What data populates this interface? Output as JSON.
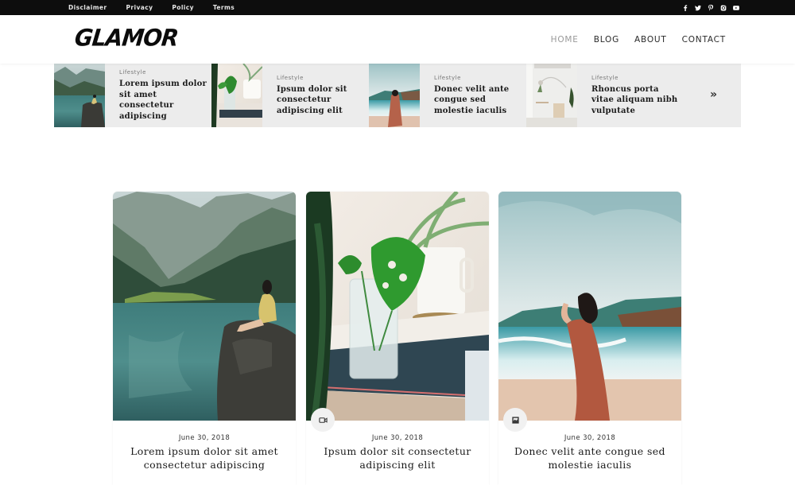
{
  "topbar": {
    "links": [
      "Disclaimer",
      "Privacy",
      "Policy",
      "Terms"
    ],
    "socials": [
      "facebook-icon",
      "twitter-icon",
      "pinterest-icon",
      "instagram-icon",
      "youtube-icon"
    ]
  },
  "header": {
    "logo": "GLAMOR",
    "nav": [
      {
        "label": "HOME",
        "active": true
      },
      {
        "label": "BLOG",
        "active": false
      },
      {
        "label": "ABOUT",
        "active": false
      },
      {
        "label": "CONTACT",
        "active": false
      }
    ]
  },
  "featured": {
    "items": [
      {
        "category": "Lifestyle",
        "title": "Lorem ipsum dolor sit amet consectetur adipiscing",
        "image": "woman-on-rock-by-mountain-lake"
      },
      {
        "category": "Lifestyle",
        "title": "Ipsum dolor sit consectetur adipiscing elit",
        "image": "plant-in-jar-on-books"
      },
      {
        "category": "Lifestyle",
        "title": "Donec velit ante congue sed molestie iaculis",
        "image": "woman-in-dress-on-beach"
      },
      {
        "category": "Lifestyle",
        "title": "Rhoncus porta vitae aliquam nibh vulputate",
        "image": "white-interior-with-plants"
      }
    ],
    "next_icon": "»"
  },
  "posts": [
    {
      "date": "June 30, 2018",
      "title": "Lorem ipsum dolor sit amet consectetur adipiscing",
      "format": null,
      "image": "woman-on-rock-by-mountain-lake"
    },
    {
      "date": "June 30, 2018",
      "title": "Ipsum dolor sit consectetur adipiscing elit",
      "format": "video-icon",
      "image": "plant-in-jar-on-books"
    },
    {
      "date": "June 30, 2018",
      "title": "Donec velit ante congue sed molestie iaculis",
      "format": "gallery-icon",
      "image": "woman-in-dress-on-beach"
    }
  ]
}
